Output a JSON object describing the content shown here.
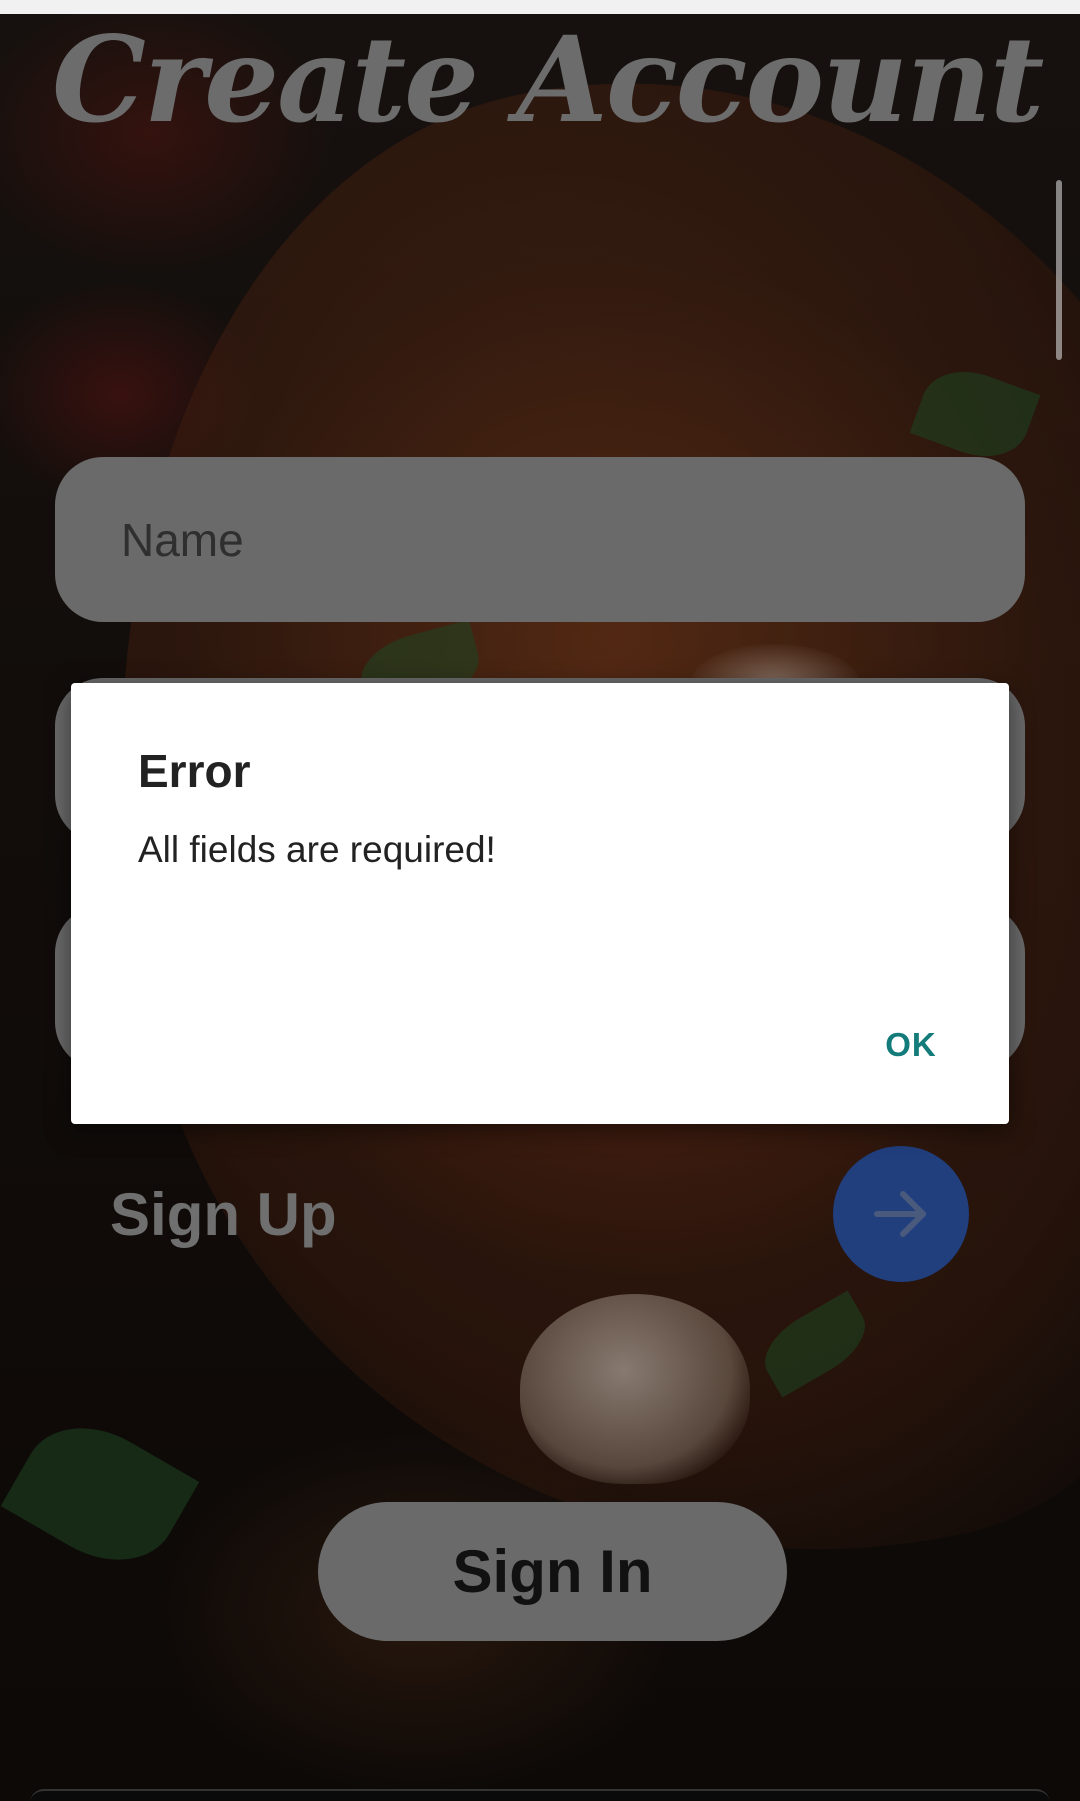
{
  "screen": {
    "title": "Create Account"
  },
  "form": {
    "name_placeholder": "Name",
    "field2_placeholder": "",
    "field3_placeholder": "",
    "signup_label": "Sign Up",
    "signin_label": "Sign In"
  },
  "dialog": {
    "title": "Error",
    "message": "All fields are required!",
    "ok_label": "OK"
  },
  "icons": {
    "signup_button_icon": "arrow-right-icon"
  },
  "colors": {
    "title": "#6c6c6c",
    "field_bg": "#6a6a6a",
    "signup_button": "#213e7d",
    "dialog_ok": "#137b7a"
  }
}
